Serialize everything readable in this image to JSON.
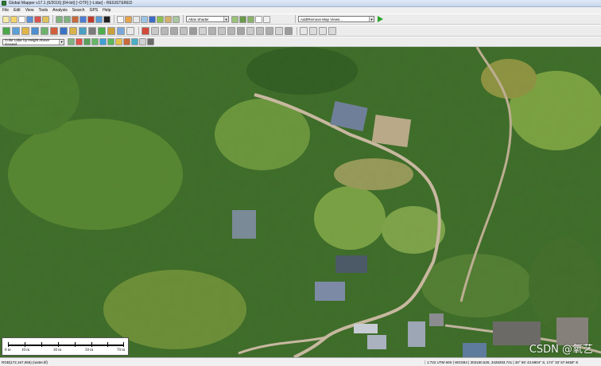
{
  "window": {
    "title": "Global Mapper v17.1 (6/2016) [64-bit] [~OTF] [~Lidar] - REGISTERED"
  },
  "menu": [
    "File",
    "Edit",
    "View",
    "Tools",
    "Analysis",
    "Search",
    "GPS",
    "Help"
  ],
  "toolbar": {
    "shader_select": "Atlas Shader",
    "map_views_select": "Add/Remove Map Views...",
    "lidar_color_select": "Color Lidar by Height Above Ground"
  },
  "scale_bar": {
    "labels": [
      "0 m",
      "10 m",
      "30 m",
      "50 m",
      "70 m"
    ]
  },
  "watermark": "CSDN @氧艺",
  "status": {
    "left": "RGB(172,167,065) (raster.tif)",
    "right": "1:722   UTM 60S | WGS84 | 303150.525, 3428293.721 | 30° 55' 43.6904\" S, 174° 33' 57.9458\" E"
  },
  "colors": {
    "map_vegetation": "#3f6e2a",
    "map_roads": "#c8b8a0",
    "roof": "#6f7f99",
    "play": "#2aa52a"
  }
}
